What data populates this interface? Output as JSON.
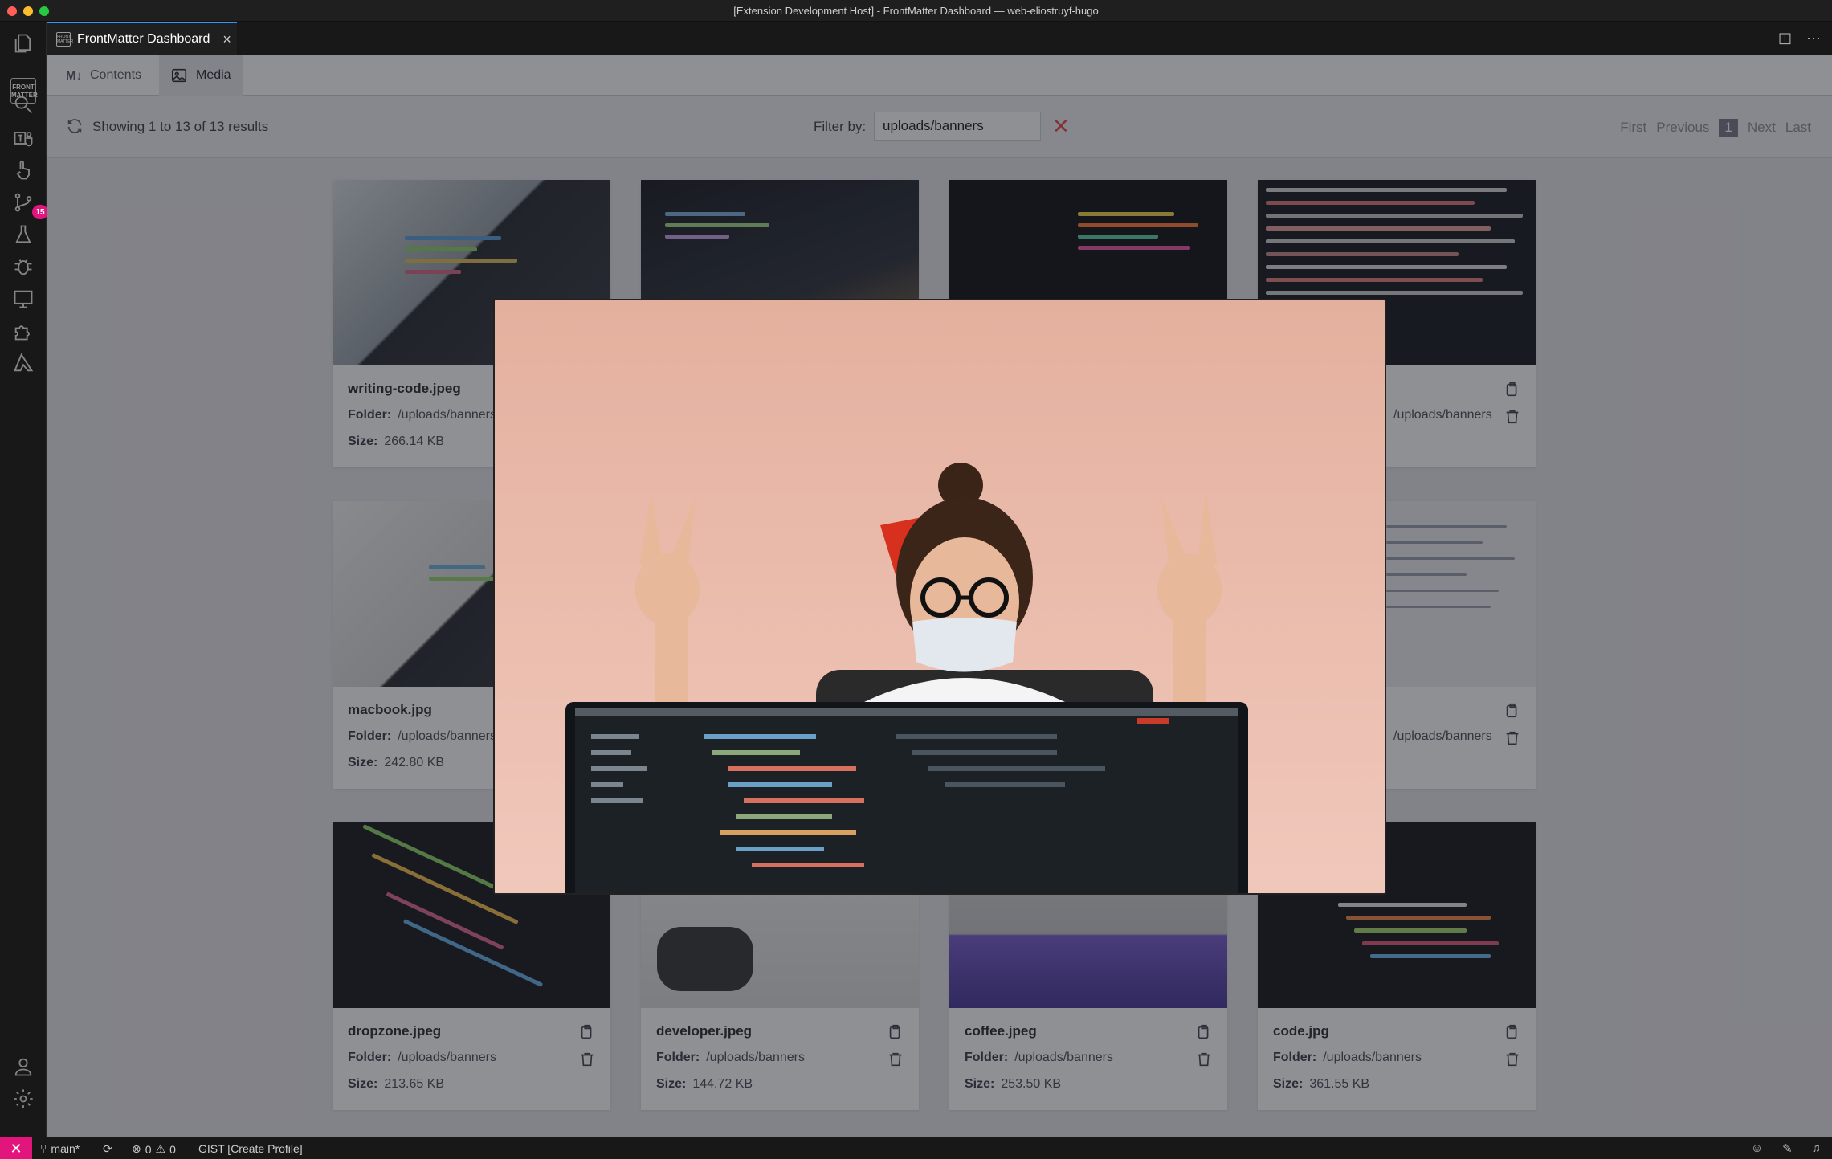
{
  "window": {
    "title": "[Extension Development Host] - FrontMatter Dashboard — web-eliostruyf-hugo"
  },
  "activity_bar": {
    "logo_text": "FRONT MATTER",
    "scm_badge": "15"
  },
  "editor_tab": {
    "label": "FrontMatter Dashboard",
    "icon_text": "FRONT MATTER"
  },
  "nav": {
    "tabs": [
      {
        "label": "Contents",
        "icon": "markdown-icon"
      },
      {
        "label": "Media",
        "icon": "image-icon"
      }
    ],
    "active": "Media"
  },
  "toolbar": {
    "results": "Showing 1 to 13 of 13 results",
    "filter_label": "Filter by:",
    "filter_value": "uploads/banners",
    "pagination": {
      "first": "First",
      "previous": "Previous",
      "current": "1",
      "next": "Next",
      "last": "Last"
    }
  },
  "labels": {
    "folder": "Folder:",
    "size": "Size:"
  },
  "media": [
    {
      "name": "writing-code.jpeg",
      "folder": "/uploads/banners",
      "size": "266.14 KB"
    },
    {
      "name": "",
      "folder": "",
      "size": ""
    },
    {
      "name": "",
      "folder": "",
      "size": ""
    },
    {
      "name": "",
      "folder": "/uploads/banners",
      "size": ""
    },
    {
      "name": "macbook.jpg",
      "folder": "/uploads/banners",
      "size": "242.80 KB"
    },
    {
      "name": "",
      "folder": "/uploads/banners",
      "size": ""
    },
    {
      "name": "dropzone.jpeg",
      "folder": "/uploads/banners",
      "size": "213.65 KB"
    },
    {
      "name": "developer.jpeg",
      "folder": "/uploads/banners",
      "size": "144.72 KB"
    },
    {
      "name": "coffee.jpeg",
      "folder": "/uploads/banners",
      "size": "253.50 KB"
    },
    {
      "name": "code.jpg",
      "folder": "/uploads/banners",
      "size": "361.55 KB"
    }
  ],
  "statusbar": {
    "branch": "main*",
    "errors": "0",
    "warnings": "0",
    "gist": "GIST [Create Profile]"
  },
  "colors": {
    "accent": "#3794ff",
    "badge": "#e2157d",
    "clear_filter": "#e74c4c",
    "dashboard_bg": "#e6e6ea"
  }
}
